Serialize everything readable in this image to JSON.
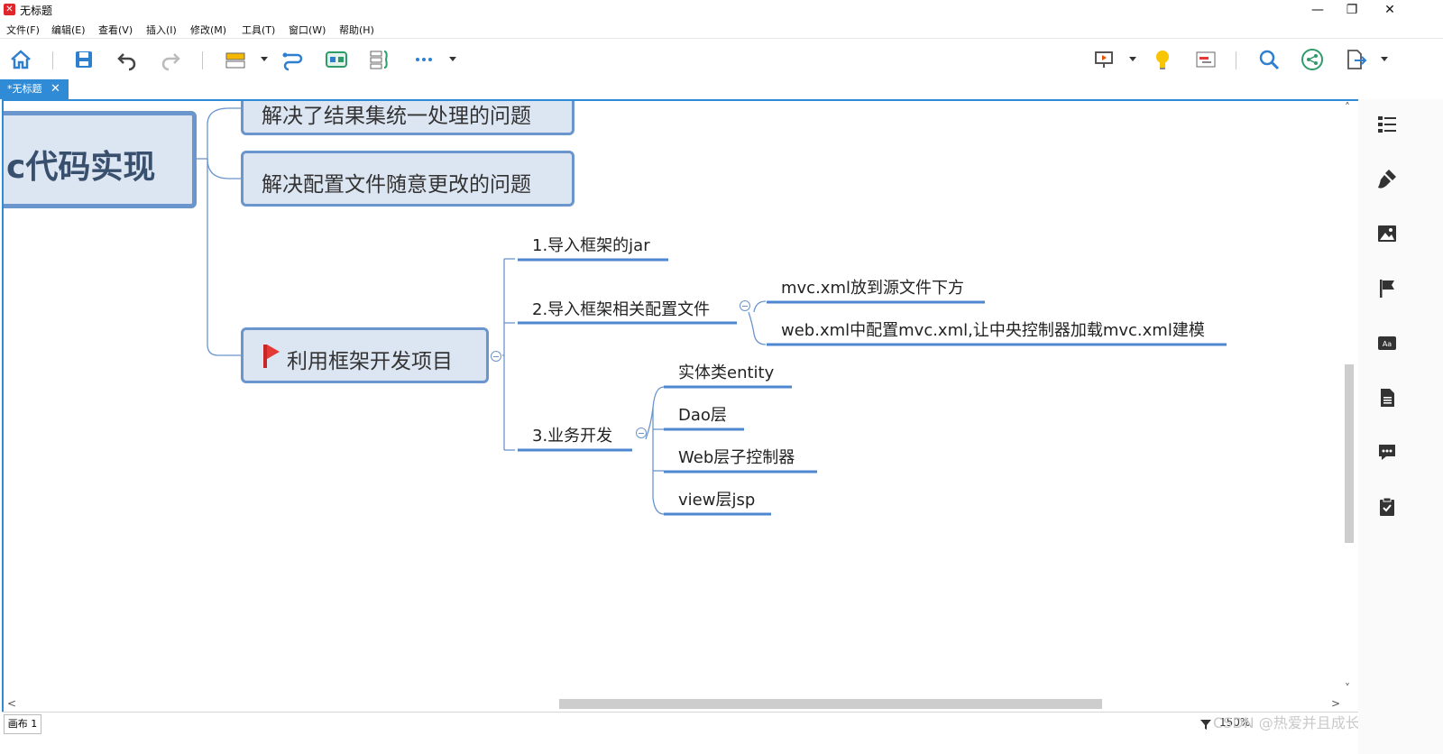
{
  "window": {
    "title": "无标题",
    "app_icon_glyph": "✕",
    "minimize": "—",
    "restore": "❐",
    "close": "✕"
  },
  "menu": [
    "文件(F)",
    "编辑(E)",
    "查看(V)",
    "插入(I)",
    "修改(M)",
    "工具(T)",
    "窗口(W)",
    "帮助(H)"
  ],
  "tab": {
    "label": "*无标题",
    "close": "✕"
  },
  "mindmap": {
    "central": "c代码实现",
    "main_topics": [
      "解决了结果集统一处理的问题",
      "解决配置文件随意更改的问题",
      "利用框架开发项目"
    ],
    "subtopics": {
      "import_jar": "1.导入框架的jar",
      "import_config": "2.导入框架相关配置文件",
      "config_children": [
        "mvc.xml放到源文件下方",
        "web.xml中配置mvc.xml,让中央控制器加载mvc.xml建模"
      ],
      "business": "3.业务开发",
      "business_children": [
        "实体类entity",
        "Dao层",
        "Web层子控制器",
        "view层jsp"
      ]
    },
    "marker_icon": "flag-icon",
    "colors": {
      "node_fill": "#dce5f2",
      "node_border": "#6b95cd",
      "line": "#6b95cd",
      "flag": "#e53935"
    }
  },
  "status": {
    "sheet": "画布 1",
    "zoom": "150%"
  },
  "watermark": "CSDN @热爱并且成长着",
  "scroll": {
    "left_arrow": "<",
    "right_arrow": ">",
    "up_arrow": "˄",
    "down_arrow": "˅"
  },
  "accent_color": "#2f8bd6"
}
